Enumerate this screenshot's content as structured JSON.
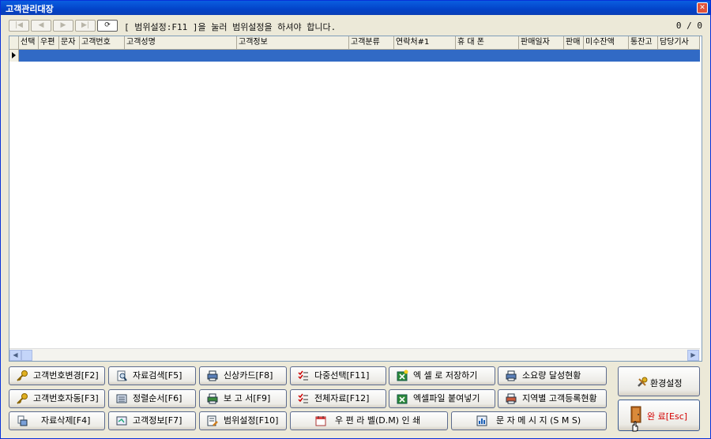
{
  "window": {
    "title": "고객관리대장"
  },
  "toolbar": {
    "nav": [
      "first",
      "prev",
      "next",
      "last",
      "refresh"
    ],
    "hint": "[ 범위설정:F11 ]을 눌러 범위설정을 하셔야 합니다.",
    "counter": "0 / 0"
  },
  "grid": {
    "columns": [
      "선택",
      "우편",
      "문자",
      "고객번호",
      "고객성명",
      "고객정보",
      "고객분류",
      "연락처#1",
      "휴 대 폰",
      "판매일자",
      "판매",
      "미수잔액",
      "통잔고",
      "담당기사"
    ]
  },
  "buttons": {
    "change_no": "고객번호변경[F2]",
    "search": "자료검색[F5]",
    "new_card": "신상카드[F8]",
    "multi_select": "다중선택[F11]",
    "excel_save": "엑 셀 로 저장하기",
    "consumption": "소요량 달성현황",
    "auto_no": "고객번호자동[F3]",
    "sort": "정렬순서[F6]",
    "report": "보 고 서[F9]",
    "all_data": "전체자료[F12]",
    "excel_paste": "엑셀파일 붙여넣기",
    "region": "지역별 고객등록현황",
    "delete": "자료삭제[F4]",
    "info": "고객정보[F7]",
    "range": "범위설정[F10]",
    "label_print": "우 편 라 벨(D.M) 인 쇄",
    "sms": "문 자 메 시 지 (S M S)",
    "settings": "환경설정",
    "done": "완 료[Esc]"
  },
  "colors": {
    "titlebar": "#0a5ee0",
    "selection": "#316ac5",
    "done_text": "#d40000"
  }
}
